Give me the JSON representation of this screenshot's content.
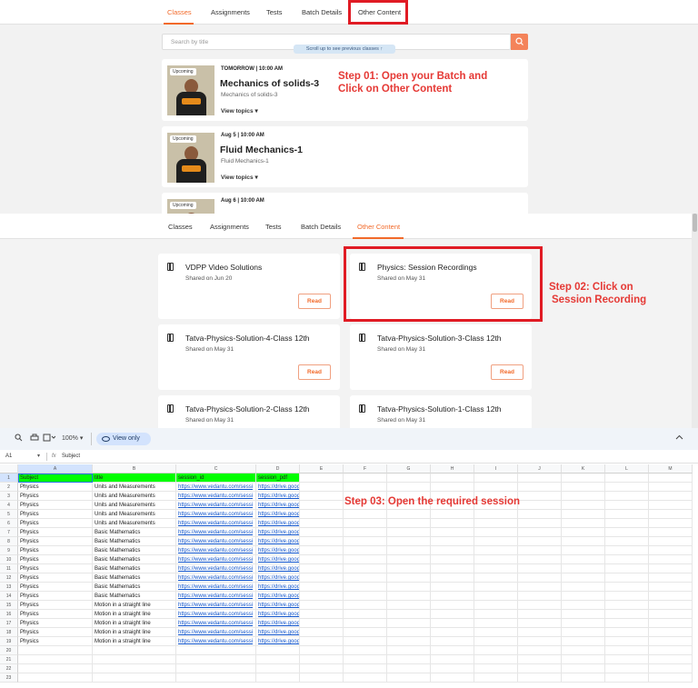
{
  "panel1": {
    "tabs": [
      {
        "label": "Classes",
        "active": true
      },
      {
        "label": "Assignments",
        "active": false
      },
      {
        "label": "Tests",
        "active": false
      },
      {
        "label": "Batch Details",
        "active": false
      },
      {
        "label": "Other Content",
        "active": false
      }
    ],
    "search_placeholder": "Search by title",
    "scroll_hint": "Scroll up to see previous classes",
    "classes": [
      {
        "badge": "Upcoming",
        "when": "TOMORROW | 10:00 AM",
        "title": "Mechanics of solids-3",
        "subtitle": "Mechanics of solids-3",
        "view_topics": "View topics"
      },
      {
        "badge": "Upcoming",
        "when": "Aug 5 | 10:00 AM",
        "title": "Fluid Mechanics-1",
        "subtitle": "Fluid Mechanics-1",
        "view_topics": "View topics"
      },
      {
        "badge": "Upcoming",
        "when": "Aug 6 | 10:00 AM",
        "title": "",
        "subtitle": "",
        "view_topics": ""
      }
    ],
    "annotation": [
      "Step 01: Open your Batch and",
      "Click on Other Content"
    ]
  },
  "panel2": {
    "tabs": [
      {
        "label": "Classes",
        "active": false
      },
      {
        "label": "Assignments",
        "active": false
      },
      {
        "label": "Tests",
        "active": false
      },
      {
        "label": "Batch Details",
        "active": false
      },
      {
        "label": "Other Content",
        "active": true
      }
    ],
    "cards": [
      {
        "title": "VDPP Video Solutions",
        "shared": "Shared on Jun 20",
        "button": "Read"
      },
      {
        "title": "Physics: Session Recordings",
        "shared": "Shared on May 31",
        "button": "Read"
      },
      {
        "title": "Tatva-Physics-Solution-4-Class 12th",
        "shared": "Shared on May 31",
        "button": "Read"
      },
      {
        "title": "Tatva-Physics-Solution-3-Class 12th",
        "shared": "Shared on May 31",
        "button": "Read"
      },
      {
        "title": "Tatva-Physics-Solution-2-Class 12th",
        "shared": "Shared on May 31",
        "button": ""
      },
      {
        "title": "Tatva-Physics-Solution-1-Class 12th",
        "shared": "Shared on May 31",
        "button": ""
      }
    ],
    "annotation": [
      "Step 02: Click on",
      "Session Recording"
    ]
  },
  "panel3": {
    "toolbar": {
      "zoom": "100%",
      "view_only": "View only"
    },
    "cell_ref": "A1",
    "formula_value": "Subject",
    "columns": [
      "A",
      "B",
      "C",
      "D",
      "E",
      "F",
      "G",
      "H",
      "I",
      "J",
      "K",
      "L",
      "M"
    ],
    "header_row": [
      "Subject",
      "title",
      "session_id",
      "session_pdf"
    ],
    "rows": [
      [
        "Physics",
        "Units and Measurements",
        "https://www.vedantu.com/sessi",
        "https://drive.goog"
      ],
      [
        "Physics",
        "Units and Measurements",
        "https://www.vedantu.com/sessi",
        "https://drive.goog"
      ],
      [
        "Physics",
        "Units and Measurements",
        "https://www.vedantu.com/sessi",
        "https://drive.goog"
      ],
      [
        "Physics",
        "Units and Measurements",
        "https://www.vedantu.com/sessi",
        "https://drive.goog"
      ],
      [
        "Physics",
        "Units and Measurements",
        "https://www.vedantu.com/sessi",
        "https://drive.goog"
      ],
      [
        "Physics",
        "Basic Mathematics",
        "https://www.vedantu.com/sessi",
        "https://drive.goog"
      ],
      [
        "Physics",
        "Basic Mathematics",
        "https://www.vedantu.com/sessi",
        "https://drive.goog"
      ],
      [
        "Physics",
        "Basic Mathematics",
        "https://www.vedantu.com/sessi",
        "https://drive.goog"
      ],
      [
        "Physics",
        "Basic Mathematics",
        "https://www.vedantu.com/sessi",
        "https://drive.goog"
      ],
      [
        "Physics",
        "Basic Mathematics",
        "https://www.vedantu.com/sessi",
        "https://drive.goog"
      ],
      [
        "Physics",
        "Basic Mathematics",
        "https://www.vedantu.com/sessi",
        "https://drive.goog"
      ],
      [
        "Physics",
        "Basic Mathematics",
        "https://www.vedantu.com/sessi",
        "https://drive.goog"
      ],
      [
        "Physics",
        "Basic Mathematics",
        "https://www.vedantu.com/sessi",
        "https://drive.goog"
      ],
      [
        "Physics",
        "Motion in a straight line",
        "https://www.vedantu.com/sessi",
        "https://drive.goog"
      ],
      [
        "Physics",
        "Motion in a straight line",
        "https://www.vedantu.com/sessi",
        "https://drive.goog"
      ],
      [
        "Physics",
        "Motion in a straight line",
        "https://www.vedantu.com/sessi",
        "https://drive.goog"
      ],
      [
        "Physics",
        "Motion in a straight line",
        "https://www.vedantu.com/sessi",
        "https://drive.goog"
      ],
      [
        "Physics",
        "Motion in a straight line",
        "https://www.vedantu.com/sessi",
        "https://drive.goog"
      ]
    ],
    "row_numbers": [
      "1",
      "2",
      "3",
      "4",
      "5",
      "6",
      "7",
      "8",
      "9",
      "10",
      "11",
      "12",
      "13",
      "14",
      "15",
      "16",
      "17",
      "18",
      "19",
      "20",
      "21",
      "22",
      "23"
    ],
    "annotation": "Step 03: Open the required session"
  },
  "colors": {
    "accent": "#f26a2a",
    "annotation": "#e53935",
    "header_green": "#00ff00",
    "link": "#1155cc"
  }
}
